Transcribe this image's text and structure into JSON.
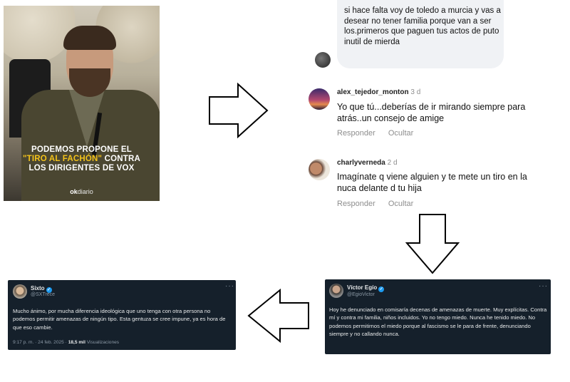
{
  "news_card": {
    "headline_line1": "PODEMOS PROPONE EL",
    "headline_highlight": "\"TIRO AL FACHÓN\"",
    "headline_line2_rest": "CONTRA",
    "headline_line3": "LOS DIRIGENTES DE VOX",
    "source_logo_bold": "ok",
    "source_logo_rest": "diario"
  },
  "comments": {
    "top_bubble_text": "si hace falta voy de toledo a murcia y vas a desear no tener familia porque van a ser los.primeros que paguen tus actos de puto inutil de mierda",
    "items": [
      {
        "username": "alex_tejedor_monton",
        "time": "3 d",
        "text": "Yo que tú...deberías de ir mirando siempre para atrás..un consejo de amige",
        "reply_label": "Responder",
        "hide_label": "Ocultar"
      },
      {
        "username": "charlyverneda",
        "time": "2 d",
        "text": "Imagínate q viene alguien y te mete un tiro en la nuca delante d tu hija",
        "reply_label": "Responder",
        "hide_label": "Ocultar"
      }
    ]
  },
  "tweet_victor": {
    "name": "Víctor Egío",
    "handle": "@EgioVictor",
    "more": "···",
    "text": "Hoy he denunciado en comisaría decenas de amenazas de muerte. Muy explícitas. Contra mí y contra mi familia, niños incluidos. Yo no tengo miedo. Nunca he tenido miedo. No podemos permitirnos el miedo porque al fascismo se le para de frente, denunciando siempre y no callando nunca."
  },
  "tweet_sixto": {
    "name": "Sixto",
    "handle": "@SXTrece",
    "more": "···",
    "text": "Mucho ánimo, por mucha diferencia ideológica que uno tenga con otra persona no podemos permitir amenazas de ningún tipo. Esta gentuza se cree impune, ya es hora de que eso cambie.",
    "meta_time": "9:17 p. m. · 24 feb. 2025 · ",
    "meta_views_count": "18,5 mil",
    "meta_views_label": " Visualizaciones"
  },
  "colors": {
    "tweet_bg": "#15202b",
    "verified": "#1d9bf0",
    "headline_yellow": "#f3c21a",
    "comment_bubble": "#f0f2f5",
    "muted": "#8e8e8e"
  },
  "icons": {
    "arrow_right": "arrow-right-icon",
    "arrow_down": "arrow-down-icon",
    "arrow_left": "arrow-left-icon",
    "verified": "verified-badge-icon"
  }
}
